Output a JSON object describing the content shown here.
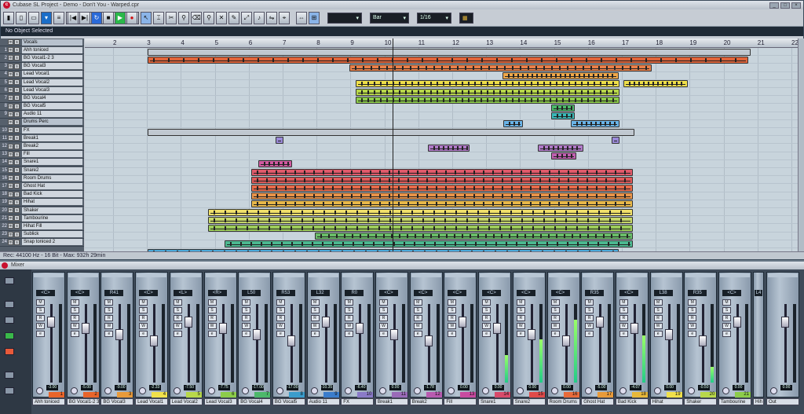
{
  "window": {
    "title": "Cubase SL Project - Demo - Don't You - Warped.cpr",
    "min": "_",
    "max": "□",
    "close": "×"
  },
  "toolbar": {
    "grid_label": "Bar",
    "quantize": "1/16",
    "grid_combo_text": "",
    "tool_icons": [
      "pointer-icon",
      "range-icon",
      "split-icon",
      "glue-icon",
      "erase-icon",
      "zoom-icon",
      "mute-icon",
      "draw-icon",
      "play-icon",
      "audition-icon"
    ]
  },
  "infoline": "No Object Selected",
  "ruler": [
    "2",
    "3",
    "4",
    "5",
    "6",
    "7",
    "8",
    "9",
    "10",
    "11",
    "12",
    "13",
    "14",
    "15",
    "16",
    "17",
    "18",
    "19",
    "20",
    "21",
    "22"
  ],
  "status": "Rec: 44100 Hz - 16 Bit - Max: 932h 29min",
  "tracks": [
    {
      "n": "",
      "name": "Vocals",
      "folder": true
    },
    {
      "n": "1",
      "name": "Ahh toniced"
    },
    {
      "n": "2",
      "name": "BG Vocal1-2 3"
    },
    {
      "n": "3",
      "name": "BG Vocal3"
    },
    {
      "n": "4",
      "name": "Lead Vocal1"
    },
    {
      "n": "5",
      "name": "Lead Vocal2"
    },
    {
      "n": "6",
      "name": "Lead Vocal3"
    },
    {
      "n": "7",
      "name": "BG Vocal4"
    },
    {
      "n": "8",
      "name": "BG Vocal5"
    },
    {
      "n": "9",
      "name": "Audio 11"
    },
    {
      "n": "",
      "name": "Drums Perc",
      "folder": true
    },
    {
      "n": "10",
      "name": "FX"
    },
    {
      "n": "11",
      "name": "Break1"
    },
    {
      "n": "12",
      "name": "Break2"
    },
    {
      "n": "13",
      "name": "Fill"
    },
    {
      "n": "14",
      "name": "Snare1"
    },
    {
      "n": "15",
      "name": "Snare2"
    },
    {
      "n": "16",
      "name": "Room Drums"
    },
    {
      "n": "17",
      "name": "Ghost Hat"
    },
    {
      "n": "18",
      "name": "Bad Kick"
    },
    {
      "n": "19",
      "name": "Hihat"
    },
    {
      "n": "20",
      "name": "Shaker"
    },
    {
      "n": "21",
      "name": "Tambourine"
    },
    {
      "n": "22",
      "name": "Hihat Fill"
    },
    {
      "n": "23",
      "name": "Sublick"
    },
    {
      "n": "24",
      "name": "Snap toniced 2"
    }
  ],
  "mixer": {
    "title": "Mixer",
    "channels": [
      {
        "name": "Ahh toniced",
        "pan": "<C>",
        "val": "-3.00",
        "num": "1",
        "color": "#e8642a",
        "level": 0.0
      },
      {
        "name": "BG Vocal1-2 3",
        "pan": "<C>",
        "val": "-5.00",
        "num": "2",
        "color": "#e8642a",
        "level": 0.0
      },
      {
        "name": "BG Vocal3",
        "pan": "R41",
        "val": "-9.00",
        "num": "3",
        "color": "#e89a3a",
        "level": 0.0
      },
      {
        "name": "Lead Vocal1",
        "pan": "<C>",
        "val": "-2.33",
        "num": "4",
        "color": "#f0e04a",
        "level": 0.0
      },
      {
        "name": "Lead Vocal2",
        "pan": "<L>",
        "val": "-7.50",
        "num": "5",
        "color": "#b8d84a",
        "level": 0.0
      },
      {
        "name": "Lead Vocal3",
        "pan": "<R>",
        "val": "-7.75",
        "num": "6",
        "color": "#8ccc4a",
        "level": 0.0
      },
      {
        "name": "BG Vocal4",
        "pan": "L50",
        "val": "-17.00",
        "num": "7",
        "color": "#4cb86a",
        "level": 0.0
      },
      {
        "name": "BG Vocal5",
        "pan": "R53",
        "val": "-17.00",
        "num": "8",
        "color": "#3a9ccc",
        "level": 0.0
      },
      {
        "name": "Audio 11",
        "pan": "L32",
        "val": "-10.35",
        "num": "9",
        "color": "#3a7ccc",
        "level": 0.0
      },
      {
        "name": "FX",
        "pan": "R0",
        "val": "-6.40",
        "num": "10",
        "color": "#8a7ac8",
        "level": 0.0
      },
      {
        "name": "Break1",
        "pan": "<C>",
        "val": "0.00",
        "num": "11",
        "color": "#9a6ab8",
        "level": 0.0
      },
      {
        "name": "Break2",
        "pan": "<C>",
        "val": "-1.78",
        "num": "12",
        "color": "#b85ab0",
        "level": 0.0
      },
      {
        "name": "Fill",
        "pan": "<C>",
        "val": "0.00",
        "num": "13",
        "color": "#c84aa0",
        "level": 0.0
      },
      {
        "name": "Snare1",
        "pan": "<C>",
        "val": "0.00",
        "num": "14",
        "color": "#d84a6a",
        "level": 0.35
      },
      {
        "name": "Snare2",
        "pan": "<C>",
        "val": "0.00",
        "num": "15",
        "color": "#e04a4a",
        "level": 0.55
      },
      {
        "name": "Room Drums",
        "pan": "<C>",
        "val": "0.00",
        "num": "16",
        "color": "#e86a3a",
        "level": 0.8
      },
      {
        "name": "Ghost Hat",
        "pan": "R35",
        "val": "-5.00",
        "num": "17",
        "color": "#e89a3a",
        "level": 0.0
      },
      {
        "name": "Bad Kick",
        "pan": "<C>",
        "val": "-4.07",
        "num": "18",
        "color": "#e8b83a",
        "level": 0.6
      },
      {
        "name": "Hihat",
        "pan": "L38",
        "val": "0.00",
        "num": "19",
        "color": "#f0e04a",
        "level": 0.0
      },
      {
        "name": "Shaker",
        "pan": "R35",
        "val": "-0.50",
        "num": "20",
        "color": "#b8d84a",
        "level": 0.2
      },
      {
        "name": "Tambourine",
        "pan": "<C>",
        "val": "0.00",
        "num": "21",
        "color": "#8ccc4a",
        "level": 0.0
      }
    ],
    "partial": {
      "name": "Hih",
      "pan": "L4"
    },
    "out": {
      "name": "Out",
      "val": "0.00"
    }
  },
  "colors": {
    "accent": "#1a6ec8",
    "cursor": "#222222"
  }
}
